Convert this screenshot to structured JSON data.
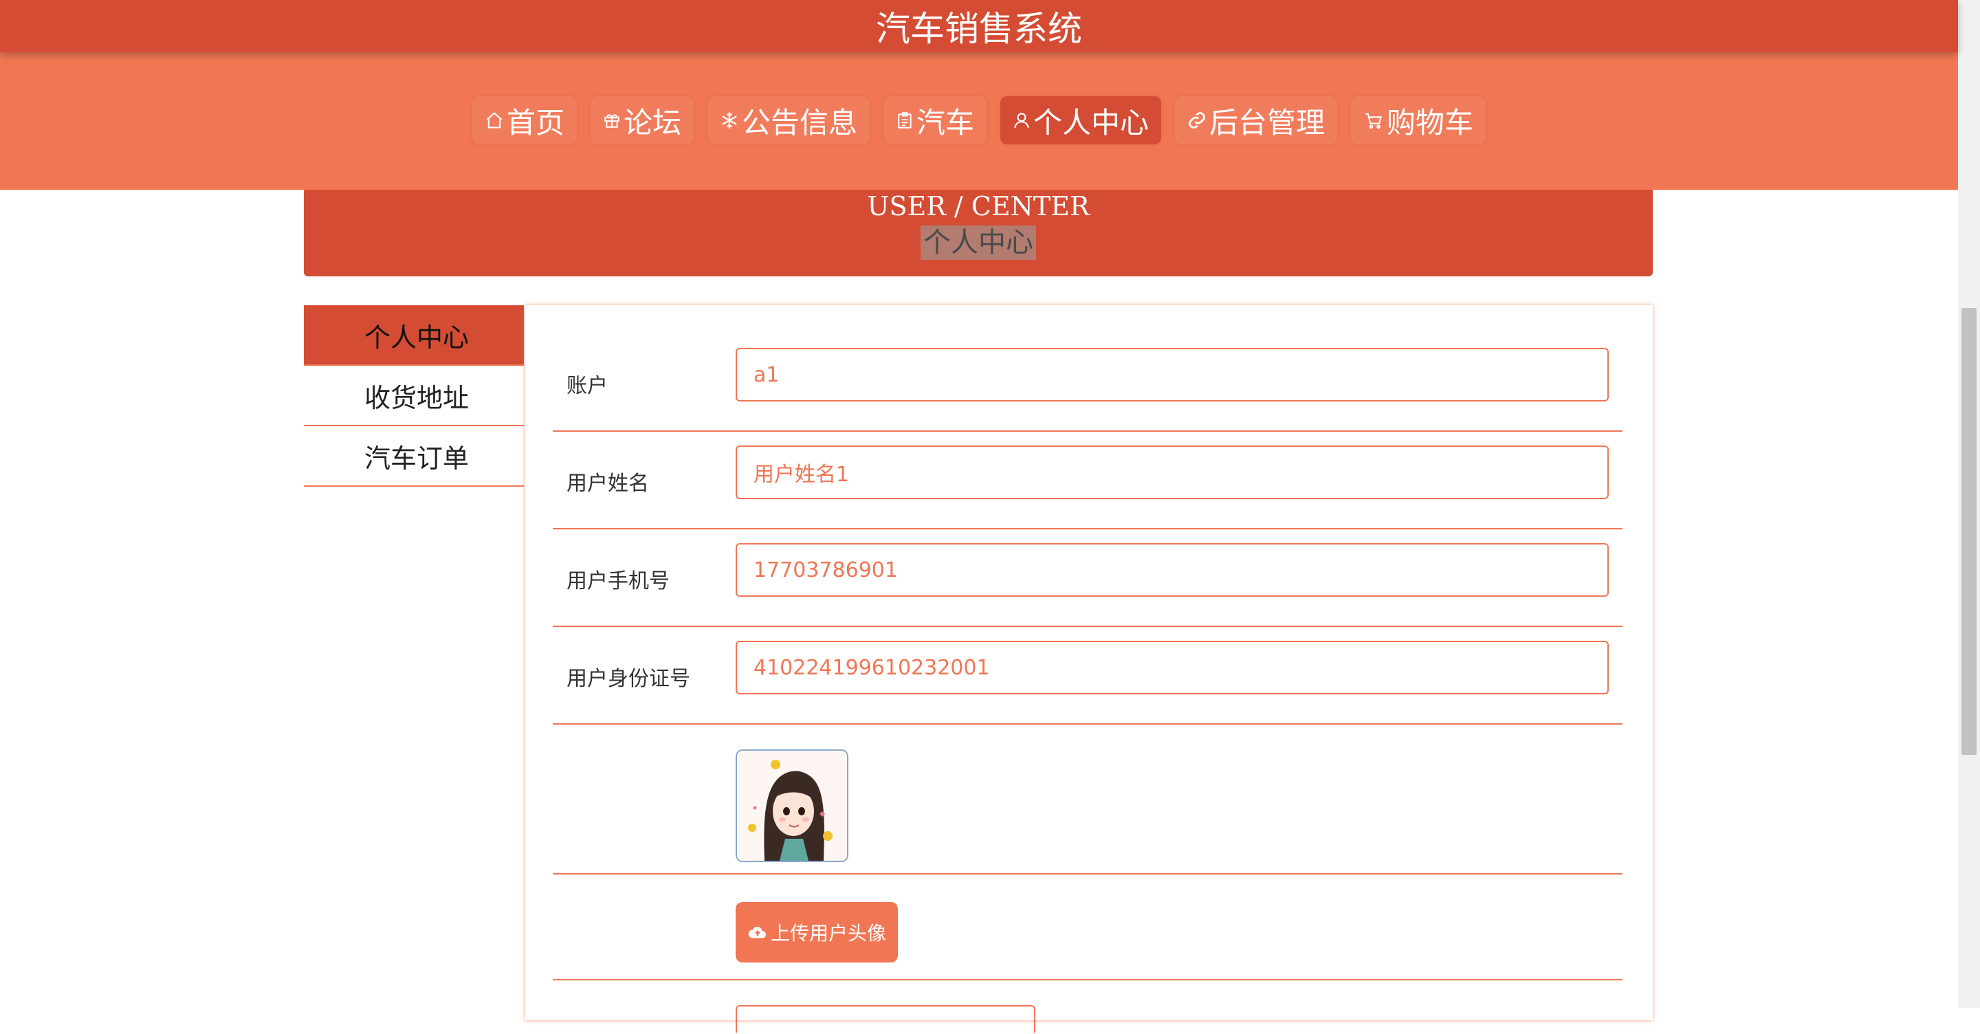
{
  "app": {
    "title": "汽车销售系统"
  },
  "nav": {
    "items": [
      {
        "label": "首页",
        "icon": "home-icon"
      },
      {
        "label": "论坛",
        "icon": "gift-icon"
      },
      {
        "label": "公告信息",
        "icon": "snowflake-icon"
      },
      {
        "label": "汽车",
        "icon": "clipboard-icon"
      },
      {
        "label": "个人中心",
        "icon": "user-icon",
        "active": true
      },
      {
        "label": "后台管理",
        "icon": "link-icon"
      },
      {
        "label": "购物车",
        "icon": "cart-icon"
      }
    ]
  },
  "banner": {
    "title_en": "USER / CENTER",
    "title_cn": "个人中心"
  },
  "sidebar": {
    "items": [
      {
        "label": "个人中心",
        "active": true
      },
      {
        "label": "收货地址"
      },
      {
        "label": "汽车订单"
      }
    ]
  },
  "form": {
    "account": {
      "label": "账户",
      "value": "a1"
    },
    "name": {
      "label": "用户姓名",
      "value": "用户姓名1"
    },
    "phone": {
      "label": "用户手机号",
      "value": "17703786901"
    },
    "id_number": {
      "label": "用户身份证号",
      "value": "410224199610232001"
    },
    "upload_label": "上传用户头像",
    "upload_icon": "cloud-upload-icon"
  },
  "colors": {
    "primary": "#d44c33",
    "accent": "#f07654",
    "text": "#333333"
  }
}
